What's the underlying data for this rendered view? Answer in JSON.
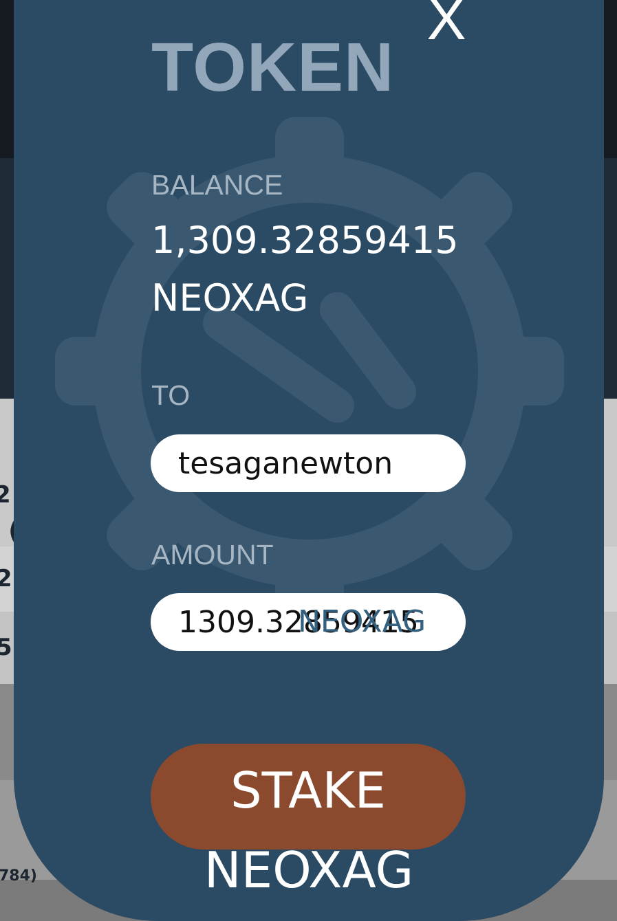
{
  "background": {
    "fragments": [
      "2",
      "(",
      "2 (",
      "5 (",
      "784)"
    ]
  },
  "modal": {
    "close_label": "X",
    "title": "TOKEN",
    "balance_label": "BALANCE",
    "balance_value": "1,309.32859415",
    "balance_unit": "NEOXAG",
    "to_label": "TO",
    "to_value": "tesaganewton",
    "amount_label": "AMOUNT",
    "amount_value": "1309.32859415",
    "amount_suffix": "NEOXAG",
    "stake_label_1": "STAKE",
    "stake_label_2": "NEOXAG"
  },
  "colors": {
    "modal_bg": "#2b4a63",
    "title": "#92a8ba",
    "stake_button": "#8b4a2e"
  }
}
